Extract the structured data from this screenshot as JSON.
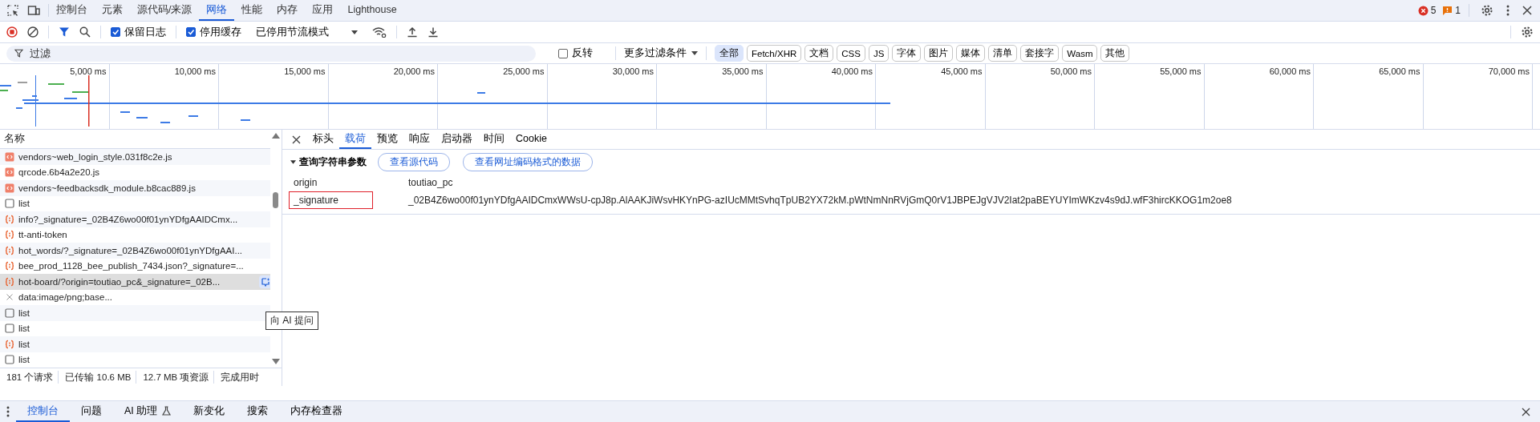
{
  "main_tabs": [
    {
      "label": "控制台",
      "selected": false
    },
    {
      "label": "元素",
      "selected": false
    },
    {
      "label": "源代码/来源",
      "selected": false
    },
    {
      "label": "网络",
      "selected": true
    },
    {
      "label": "性能",
      "selected": false
    },
    {
      "label": "内存",
      "selected": false
    },
    {
      "label": "应用",
      "selected": false
    },
    {
      "label": "Lighthouse",
      "selected": false
    }
  ],
  "error_count": "5",
  "warning_count": "1",
  "toolbar": {
    "recording": true,
    "preserve_log": {
      "label": "保留日志",
      "checked": true
    },
    "disable_cache": {
      "label": "停用缓存",
      "checked": true
    },
    "throttle": "已停用节流模式"
  },
  "filter": {
    "placeholder": "过滤",
    "invert": {
      "label": "反转",
      "checked": false
    },
    "more_filters": "更多过滤条件",
    "types": [
      {
        "label": "全部",
        "selected": true
      },
      {
        "label": "Fetch/XHR",
        "selected": false
      },
      {
        "label": "文档",
        "selected": false
      },
      {
        "label": "CSS",
        "selected": false
      },
      {
        "label": "JS",
        "selected": false
      },
      {
        "label": "字体",
        "selected": false
      },
      {
        "label": "图片",
        "selected": false
      },
      {
        "label": "媒体",
        "selected": false
      },
      {
        "label": "清单",
        "selected": false
      },
      {
        "label": "套接字",
        "selected": false
      },
      {
        "label": "Wasm",
        "selected": false
      },
      {
        "label": "其他",
        "selected": false
      }
    ]
  },
  "timeline": {
    "ticks": [
      "5,000 ms",
      "10,000 ms",
      "15,000 ms",
      "20,000 ms",
      "25,000 ms",
      "30,000 ms",
      "35,000 ms",
      "40,000 ms",
      "45,000 ms",
      "50,000 ms",
      "55,000 ms",
      "60,000 ms",
      "65,000 ms",
      "70,000 ms"
    ]
  },
  "requests": {
    "column": "名称",
    "rows": [
      {
        "name": "vendors~web_login_style.031f8c2e.js",
        "kind": "script",
        "selected": false
      },
      {
        "name": "qrcode.6b4a2e20.js",
        "kind": "script",
        "selected": false
      },
      {
        "name": "vendors~feedbacksdk_module.b8cac889.js",
        "kind": "script",
        "selected": false
      },
      {
        "name": "list",
        "kind": "document",
        "selected": false
      },
      {
        "name": "info?_signature=_02B4Z6wo00f01ynYDfgAAIDCmx...",
        "kind": "fetch",
        "selected": false
      },
      {
        "name": "tt-anti-token",
        "kind": "fetch",
        "selected": false
      },
      {
        "name": "hot_words/?_signature=_02B4Z6wo00f01ynYDfgAAI...",
        "kind": "fetch",
        "selected": false
      },
      {
        "name": "bee_prod_1128_bee_publish_7434.json?_signature=...",
        "kind": "fetch",
        "selected": false
      },
      {
        "name": "hot-board/?origin=toutiao_pc&_signature=_02B...",
        "kind": "fetch",
        "selected": true
      },
      {
        "name": "data:image/png;base...",
        "kind": "image",
        "selected": false
      },
      {
        "name": "list",
        "kind": "document",
        "selected": false
      },
      {
        "name": "list",
        "kind": "document",
        "selected": false
      },
      {
        "name": "list",
        "kind": "fetch",
        "selected": false
      },
      {
        "name": "list",
        "kind": "document",
        "selected": false
      }
    ]
  },
  "tooltip": "向 AI 提问",
  "detail_tabs": [
    {
      "label": "标头",
      "selected": false
    },
    {
      "label": "载荷",
      "selected": true
    },
    {
      "label": "预览",
      "selected": false
    },
    {
      "label": "响应",
      "selected": false
    },
    {
      "label": "启动器",
      "selected": false
    },
    {
      "label": "时间",
      "selected": false
    },
    {
      "label": "Cookie",
      "selected": false
    }
  ],
  "payload": {
    "section": "查询字符串参数",
    "expanded": true,
    "buttons": [
      "查看源代码",
      "查看网址编码格式的数据"
    ],
    "params": [
      {
        "key": "origin",
        "value": "toutiao_pc",
        "highlighted": false
      },
      {
        "key": "_signature",
        "value": "_02B4Z6wo00f01ynYDfgAAIDCmxWWsU-cpJ8p.AlAAKJiWsvHKYnPG-azIUcMMtSvhqTpUB2YX72kM.pWtNmNnRVjGmQ0rV1JBPEJgVJV2Iat2paBEYUYImWKzv4s9dJ.wfF3hircKKOG1m2oe8",
        "highlighted": true
      }
    ]
  },
  "status": [
    "181 个请求",
    "已传输 10.6 MB",
    "12.7 MB 项资源",
    "完成用时"
  ],
  "drawer_tabs": [
    {
      "label": "控制台",
      "selected": true
    },
    {
      "label": "问题",
      "selected": false
    },
    {
      "label": "AI 助理",
      "selected": false,
      "flask": true
    },
    {
      "label": "新变化",
      "selected": false
    },
    {
      "label": "搜索",
      "selected": false
    },
    {
      "label": "内存检查器",
      "selected": false
    }
  ]
}
